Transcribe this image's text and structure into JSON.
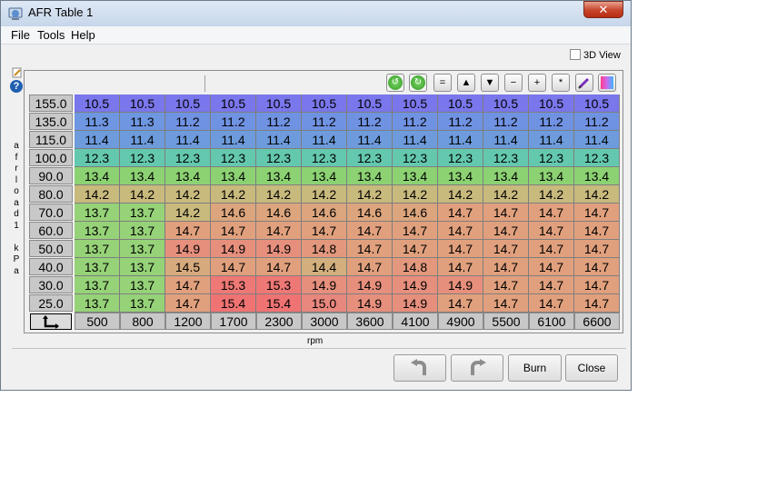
{
  "window": {
    "title": "AFR Table 1",
    "close_glyph": "✕"
  },
  "menu": {
    "file": "File",
    "tools": "Tools",
    "help": "Help"
  },
  "view3d_label": "3D View",
  "help_glyph": "?",
  "y_axis_label": [
    "a",
    "f",
    "r",
    "l",
    "o",
    "a",
    "d",
    "1",
    "",
    "k",
    "P",
    "a"
  ],
  "x_axis_label": "rpm",
  "toolbar": {
    "buttons": [
      {
        "name": "rotate-left-icon",
        "glyph": "↺"
      },
      {
        "name": "rotate-right-icon",
        "glyph": "↻"
      },
      {
        "name": "equals-icon",
        "glyph": "="
      },
      {
        "name": "increment-icon",
        "glyph": "▲"
      },
      {
        "name": "decrement-icon",
        "glyph": "▼"
      },
      {
        "name": "minus-icon",
        "glyph": "−"
      },
      {
        "name": "plus-icon",
        "glyph": "+"
      },
      {
        "name": "multiply-icon",
        "glyph": "*"
      },
      {
        "name": "pencil-icon",
        "glyph": ""
      },
      {
        "name": "color-map-icon",
        "glyph": ""
      }
    ]
  },
  "table": {
    "rows": [
      "155.0",
      "135.0",
      "115.0",
      "100.0",
      "90.0",
      "80.0",
      "70.0",
      "60.0",
      "50.0",
      "40.0",
      "30.0",
      "25.0"
    ],
    "cols": [
      "500",
      "800",
      "1200",
      "1700",
      "2300",
      "3000",
      "3600",
      "4100",
      "4900",
      "5500",
      "6100",
      "6600"
    ],
    "values": [
      [
        "10.5",
        "10.5",
        "10.5",
        "10.5",
        "10.5",
        "10.5",
        "10.5",
        "10.5",
        "10.5",
        "10.5",
        "10.5",
        "10.5"
      ],
      [
        "11.3",
        "11.3",
        "11.2",
        "11.2",
        "11.2",
        "11.2",
        "11.2",
        "11.2",
        "11.2",
        "11.2",
        "11.2",
        "11.2"
      ],
      [
        "11.4",
        "11.4",
        "11.4",
        "11.4",
        "11.4",
        "11.4",
        "11.4",
        "11.4",
        "11.4",
        "11.4",
        "11.4",
        "11.4"
      ],
      [
        "12.3",
        "12.3",
        "12.3",
        "12.3",
        "12.3",
        "12.3",
        "12.3",
        "12.3",
        "12.3",
        "12.3",
        "12.3",
        "12.3"
      ],
      [
        "13.4",
        "13.4",
        "13.4",
        "13.4",
        "13.4",
        "13.4",
        "13.4",
        "13.4",
        "13.4",
        "13.4",
        "13.4",
        "13.4"
      ],
      [
        "14.2",
        "14.2",
        "14.2",
        "14.2",
        "14.2",
        "14.2",
        "14.2",
        "14.2",
        "14.2",
        "14.2",
        "14.2",
        "14.2"
      ],
      [
        "13.7",
        "13.7",
        "14.2",
        "14.6",
        "14.6",
        "14.6",
        "14.6",
        "14.6",
        "14.7",
        "14.7",
        "14.7",
        "14.7"
      ],
      [
        "13.7",
        "13.7",
        "14.7",
        "14.7",
        "14.7",
        "14.7",
        "14.7",
        "14.7",
        "14.7",
        "14.7",
        "14.7",
        "14.7"
      ],
      [
        "13.7",
        "13.7",
        "14.9",
        "14.9",
        "14.9",
        "14.8",
        "14.7",
        "14.7",
        "14.7",
        "14.7",
        "14.7",
        "14.7"
      ],
      [
        "13.7",
        "13.7",
        "14.5",
        "14.7",
        "14.7",
        "14.4",
        "14.7",
        "14.8",
        "14.7",
        "14.7",
        "14.7",
        "14.7"
      ],
      [
        "13.7",
        "13.7",
        "14.7",
        "15.3",
        "15.3",
        "14.9",
        "14.9",
        "14.9",
        "14.9",
        "14.7",
        "14.7",
        "14.7"
      ],
      [
        "13.7",
        "13.7",
        "14.7",
        "15.4",
        "15.4",
        "15.0",
        "14.9",
        "14.9",
        "14.7",
        "14.7",
        "14.7",
        "14.7"
      ]
    ]
  },
  "buttons": {
    "undo": "undo-icon",
    "redo": "redo-icon",
    "burn": "Burn",
    "close": "Close"
  },
  "colors": {
    "accent": "#1f5fb0"
  }
}
